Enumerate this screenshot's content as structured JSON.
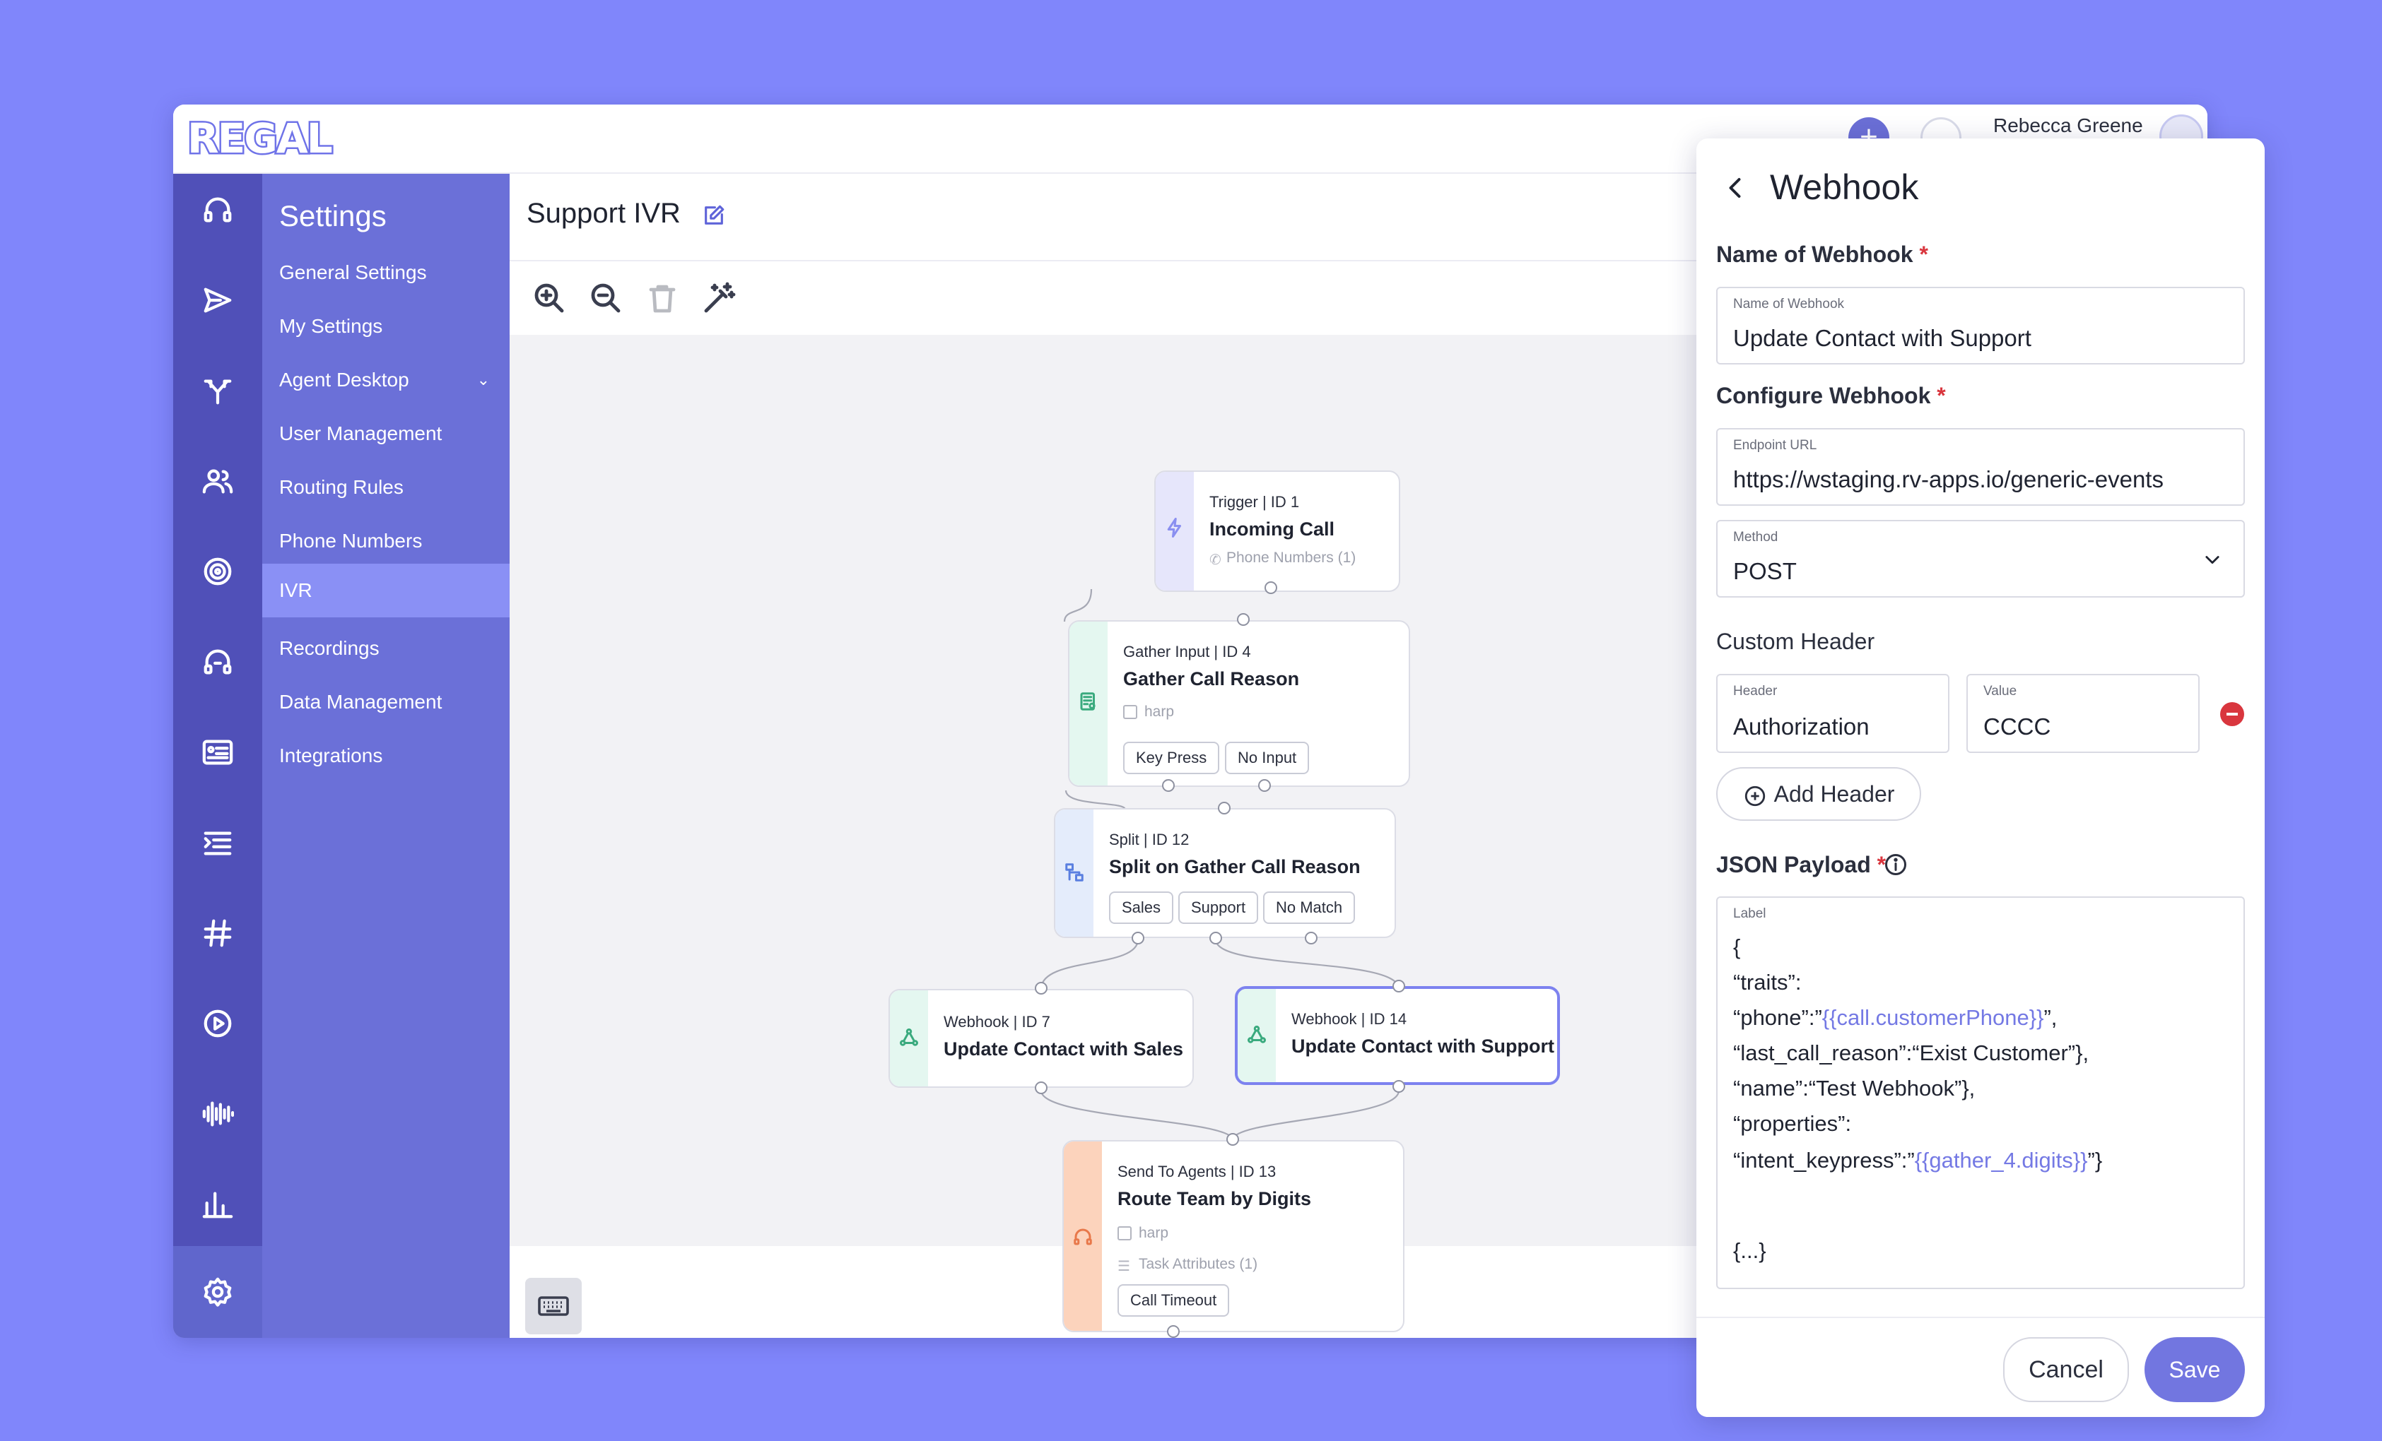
{
  "app": {
    "logo": "REGAL",
    "user_name": "Rebecca Greene",
    "add_button": "+"
  },
  "rail": {
    "icons": [
      "headset-icon",
      "send-icon",
      "routing-icon",
      "users-icon",
      "at-sign-icon",
      "headphones-icon",
      "id-card-icon",
      "list-icon",
      "hash-icon",
      "play-icon",
      "waveform-icon",
      "bar-chart-icon",
      "settings-gear-icon"
    ]
  },
  "menu": {
    "title": "Settings",
    "items": [
      {
        "label": "General Settings"
      },
      {
        "label": "My Settings"
      },
      {
        "label": "Agent Desktop",
        "chevron": "⌄"
      },
      {
        "label": "User Management"
      },
      {
        "label": "Routing Rules"
      },
      {
        "label": "Phone Numbers"
      },
      {
        "label": "IVR",
        "active": true
      },
      {
        "label": "Recordings"
      },
      {
        "label": "Data Management"
      },
      {
        "label": "Integrations"
      }
    ]
  },
  "canvas": {
    "title": "Support IVR",
    "tools": [
      "zoom-in-icon",
      "zoom-out-icon",
      "trash-icon",
      "magic-wand-icon"
    ],
    "nodes": {
      "trigger": {
        "type": "Trigger | ID 1",
        "name": "Incoming Call",
        "sub": "Phone Numbers (1)",
        "accent": "#e6e6fb",
        "icon_color": "#8a8ff0"
      },
      "gather": {
        "type": "Gather Input | ID 4",
        "name": "Gather Call Reason",
        "sub": "harp",
        "chips": [
          "Key Press",
          "No Input"
        ],
        "accent": "#e4f7f0",
        "icon_color": "#3aaa7e"
      },
      "split": {
        "type": "Split | ID 12",
        "name": "Split on Gather Call Reason",
        "chips": [
          "Sales",
          "Support",
          "No Match"
        ],
        "accent": "#e4ecfb",
        "icon_color": "#5a7fe0"
      },
      "webhook_sales": {
        "type": "Webhook | ID 7",
        "name": "Update Contact with Sales",
        "accent": "#e4f7f0",
        "icon_color": "#3aaa7e"
      },
      "webhook_support": {
        "type": "Webhook | ID 14",
        "name": "Update Contact with Support",
        "accent": "#e4f7f0",
        "icon_color": "#3aaa7e"
      },
      "agents": {
        "type": "Send To Agents | ID 13",
        "name": "Route Team by Digits",
        "sub": "harp",
        "sub2": "Task Attributes (1)",
        "chips": [
          "Call Timeout"
        ],
        "accent": "#fcd3bc",
        "icon_color": "#e8784a"
      }
    }
  },
  "panel": {
    "title": "Webhook",
    "name_section": "Name of Webhook",
    "name_field": {
      "label": "Name of Webhook",
      "value": "Update Contact with Support"
    },
    "config_section": "Configure Webhook",
    "endpoint": {
      "label": "Endpoint URL",
      "value": "https://wstaging.rv-apps.io/generic-events"
    },
    "method": {
      "label": "Method",
      "value": "POST"
    },
    "custom_header_section": "Custom Header",
    "header": {
      "label": "Header",
      "value": "Authorization"
    },
    "header_value": {
      "label": "Value",
      "value": "CCCC"
    },
    "add_header": "Add Header",
    "json_section": "JSON Payload",
    "required_mark": "*",
    "json": {
      "label": "Label",
      "lines": [
        {
          "text": "{"
        },
        {
          "text": "“traits”:"
        },
        {
          "text": "“phone”:”",
          "tmpl": "{{call.customerPhone}}",
          "tail": "”,"
        },
        {
          "text": "“last_call_reason”:“Exist Customer”},"
        },
        {
          "text": "“name”:“Test Webhook”},"
        },
        {
          "text": "“properties”:"
        },
        {
          "text": "“intent_keypress”:”",
          "tmpl": "{{gather_4.digits}}",
          "tail": "”}"
        }
      ],
      "footer_icon": "{...}"
    },
    "cancel": "Cancel",
    "save": "Save"
  }
}
